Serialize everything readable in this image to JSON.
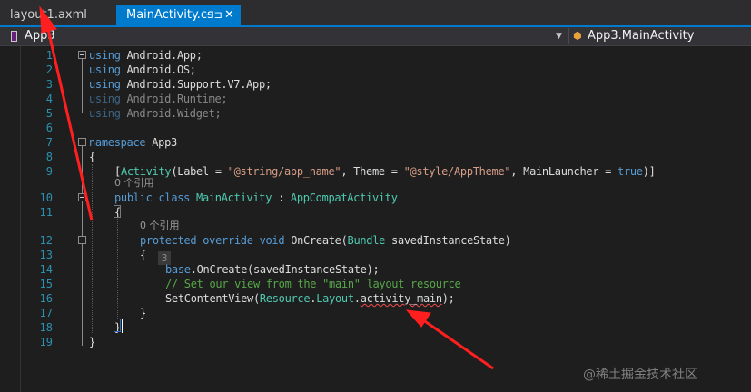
{
  "tabs": {
    "tab1_label": "layout1.axml",
    "tab2_label": "MainActivity.cs",
    "tab2_pin": "⊣⊐",
    "tab2_close": "✕"
  },
  "navbar": {
    "project": "App3",
    "member": "App3.MainActivity",
    "dropdown_glyph": "▼"
  },
  "editor": {
    "line_numbers": [
      "1",
      "2",
      "3",
      "4",
      "5",
      "6",
      "7",
      "8",
      "9",
      "10",
      "11",
      "12",
      "13",
      "14",
      "15",
      "16",
      "17",
      "18",
      "19"
    ],
    "refs_label": "0 个引用",
    "badge": "3",
    "lines": {
      "l1_kw": "using",
      "l1_rest": " Android.App;",
      "l2_kw": "using",
      "l2_rest": " Android.OS;",
      "l3_kw": "using",
      "l3_rest": " Android.Support.V7.App;",
      "l4_kw": "using",
      "l4_rest": " Android.Runtime;",
      "l5_kw": "using",
      "l5_rest": " Android.Widget;",
      "l7_kw": "namespace",
      "l7_rest": " App3",
      "l8": "{",
      "l9_a": "[",
      "l9_attr": "Activity",
      "l9_b": "(Label = ",
      "l9_s1": "\"@string/app_name\"",
      "l9_c": ", Theme = ",
      "l9_s2": "\"@style/AppTheme\"",
      "l9_d": ", MainLauncher = ",
      "l9_true": "true",
      "l9_e": ")]",
      "l10_kw": "public class",
      "l10_name": " MainActivity",
      "l10_colon": " : ",
      "l10_base": "AppCompatActivity",
      "l11": "{",
      "l12_kw": "protected override void",
      "l12_name": " OnCreate(",
      "l12_type": "Bundle",
      "l12_rest": " savedInstanceState)",
      "l13": "{",
      "l14_kw": "base",
      "l14_rest": ".OnCreate(savedInstanceState);",
      "l15": "// Set our view from the \"main\" layout resource",
      "l16_a": "SetContentView(",
      "l16_res": "Resource",
      "l16_dot1": ".",
      "l16_layout": "Layout",
      "l16_dot2": ".",
      "l16_am": "activity_main",
      "l16_end": ");",
      "l17": "}",
      "l18": "}",
      "l19": "}"
    }
  },
  "watermark": "@稀土掘金技术社区",
  "colors": {
    "accent": "#007acc",
    "keyword": "#569cd6",
    "type": "#4ec9b0",
    "string": "#d69d85",
    "comment": "#57a64a",
    "arrow": "#ff1f1f"
  }
}
